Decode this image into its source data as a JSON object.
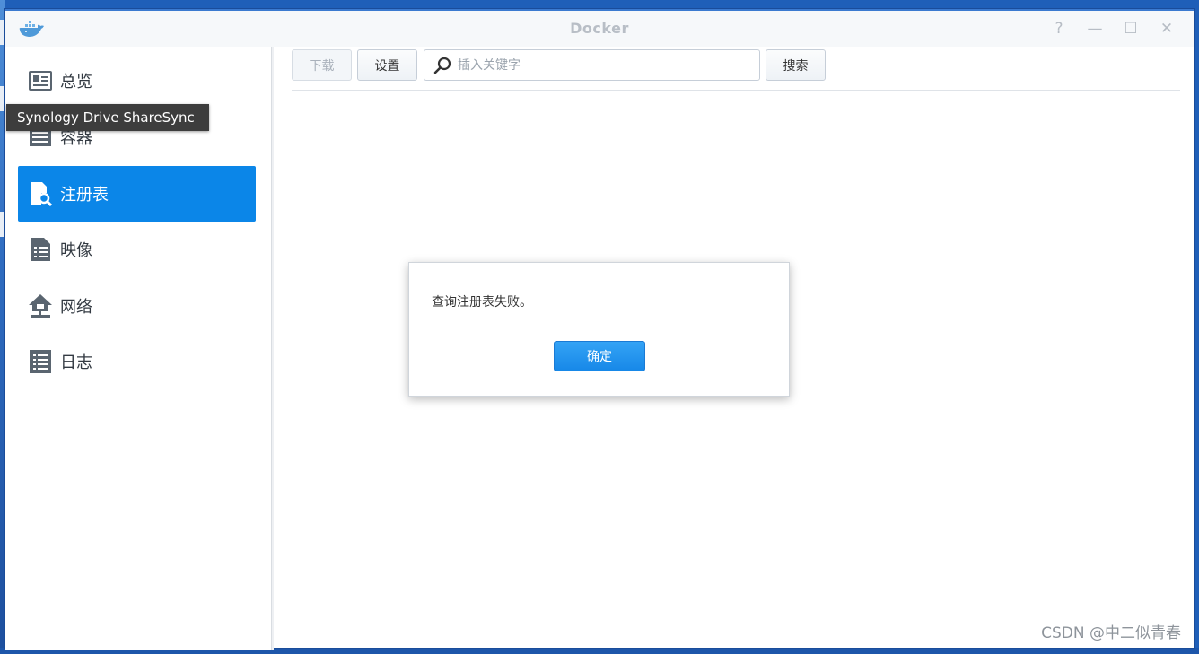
{
  "window": {
    "title": "Docker",
    "controls": {
      "help": "?",
      "minimize": "—",
      "maximize": "☐",
      "close": "✕"
    }
  },
  "sidebar": {
    "items": [
      {
        "label": "总览",
        "icon": "overview-icon",
        "active": false
      },
      {
        "label": "容器",
        "icon": "container-icon",
        "active": false
      },
      {
        "label": "注册表",
        "icon": "registry-icon",
        "active": true
      },
      {
        "label": "映像",
        "icon": "image-icon",
        "active": false
      },
      {
        "label": "网络",
        "icon": "network-icon",
        "active": false
      },
      {
        "label": "日志",
        "icon": "log-icon",
        "active": false
      }
    ]
  },
  "tooltip": {
    "text": "Synology Drive ShareSync"
  },
  "toolbar": {
    "download_label": "下载",
    "settings_label": "设置",
    "search_placeholder": "插入关键字",
    "search_label": "搜索"
  },
  "dialog": {
    "message": "查询注册表失败。",
    "ok_label": "确定"
  },
  "watermark": "CSDN @中二似青春",
  "colors": {
    "accent": "#0b86e8",
    "icon_gray": "#5a6570"
  }
}
